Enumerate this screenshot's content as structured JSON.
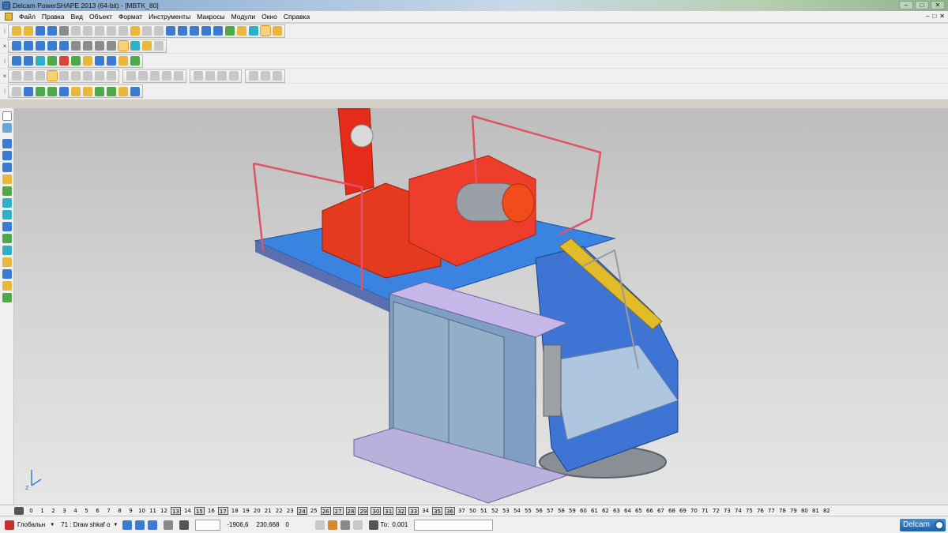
{
  "window": {
    "title": "Delcam PowerSHAPE 2013 (64-bit) - [MBTK_80]",
    "controls": [
      "–",
      "□",
      "✕"
    ]
  },
  "menu": {
    "items": [
      "Файл",
      "Правка",
      "Вид",
      "Объект",
      "Формат",
      "Инструменты",
      "Макросы",
      "Модули",
      "Окно",
      "Справка"
    ],
    "window_controls": [
      "–",
      "□",
      "✕"
    ]
  },
  "levels": {
    "items": [
      "0",
      "1",
      "2",
      "3",
      "4",
      "5",
      "6",
      "7",
      "8",
      "9",
      "10",
      "11",
      "12",
      "13",
      "14",
      "15",
      "16",
      "17",
      "18",
      "19",
      "20",
      "21",
      "22",
      "23",
      "24",
      "25",
      "26",
      "27",
      "28",
      "29",
      "30",
      "31",
      "32",
      "33",
      "34",
      "35",
      "36",
      "37",
      "50",
      "51",
      "52",
      "53",
      "54",
      "55",
      "56",
      "57",
      "58",
      "59",
      "60",
      "61",
      "62",
      "63",
      "64",
      "65",
      "66",
      "67",
      "68",
      "69",
      "70",
      "71",
      "72",
      "73",
      "74",
      "75",
      "76",
      "77",
      "78",
      "79",
      "80",
      "81",
      "82"
    ],
    "highlighted": [
      "13",
      "15",
      "17",
      "24",
      "26",
      "27",
      "28",
      "29",
      "30",
      "31",
      "32",
      "33",
      "35",
      "36"
    ]
  },
  "status": {
    "workplane": "Глобальн",
    "workplane_arrow": "▼",
    "level": "71 : Draw shkaf o",
    "level_arrow": "▼",
    "x": "-1906,6",
    "y": "230,668",
    "z": "0",
    "tolerance_label": "То:",
    "tolerance_value": "0,001",
    "brand": "Delcam"
  },
  "viewport": {
    "axis_label": "z"
  }
}
